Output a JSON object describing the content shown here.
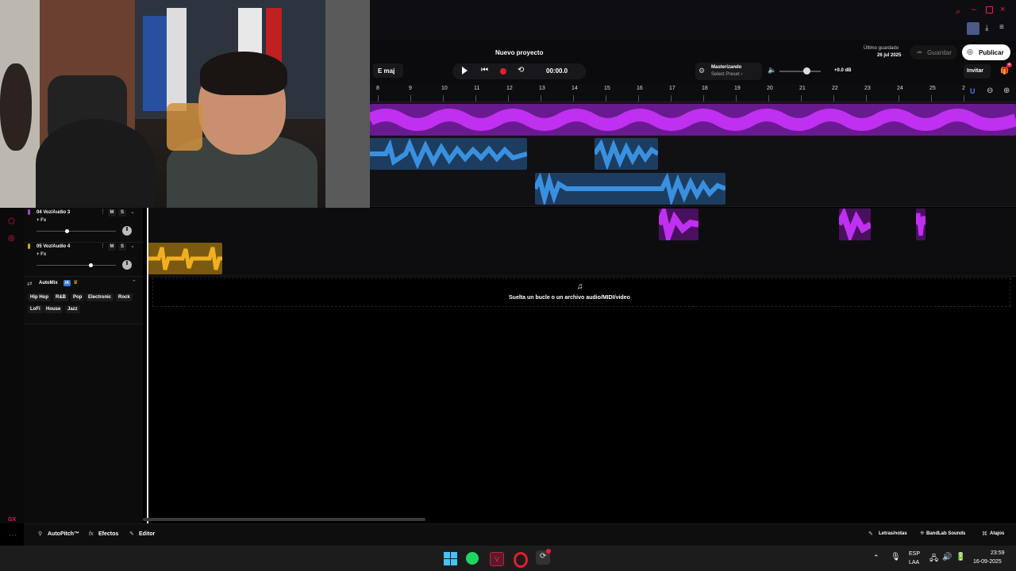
{
  "window": {
    "title": "Nuevo proyecto"
  },
  "toolbar": {
    "key": "E maj",
    "time": "00:00.0",
    "mastering_title": "Masterizando",
    "mastering_preset": "Select Preset ›",
    "volume_db": "+0.0 dB",
    "last_saved_label": "Último guardado",
    "last_saved_date": "26 jul 2025",
    "save_label": "Guardar",
    "publish_label": "Publicar",
    "invite_label": "Invitar",
    "notif_count": "4"
  },
  "ruler": {
    "ticks": [
      "8",
      "9",
      "10",
      "11",
      "12",
      "13",
      "14",
      "15",
      "16",
      "17",
      "18",
      "19",
      "20",
      "21",
      "22",
      "23",
      "24",
      "25",
      "2"
    ]
  },
  "tracks": [
    {
      "name": "04  Voz/Audio 3",
      "fx": "+ Fx",
      "mute": "M",
      "solo": "S",
      "volume": 0.38,
      "color": "#b040e0"
    },
    {
      "name": "05  Voz/Audio 4",
      "fx": "+ Fx",
      "mute": "M",
      "solo": "S",
      "volume": 0.68,
      "color": "#e0a020"
    }
  ],
  "automix": {
    "title": "AutoMix",
    "badge": "IA",
    "genres": [
      "Hip Hop",
      "R&B",
      "Pop",
      "Electronic",
      "Rock",
      "LoFi",
      "House",
      "Jazz"
    ]
  },
  "dropzone": {
    "text": "Suelta un bucle o un archivo audio/MIDI/video"
  },
  "bottom": {
    "autopitch": "AutoPitch™",
    "effects": "Efectos",
    "editor": "Editor",
    "lyrics": "Letras/notas",
    "sounds": "BandLab Sounds",
    "shortcuts": "Atajos"
  },
  "taskbar": {
    "lang1": "ESP",
    "lang2": "LAA",
    "time": "23:59",
    "date": "16-09-2025"
  },
  "colors": {
    "accent": "#e8204a",
    "purple": "#a020d0",
    "blue": "#3a8fd8",
    "gold": "#d4a020"
  }
}
